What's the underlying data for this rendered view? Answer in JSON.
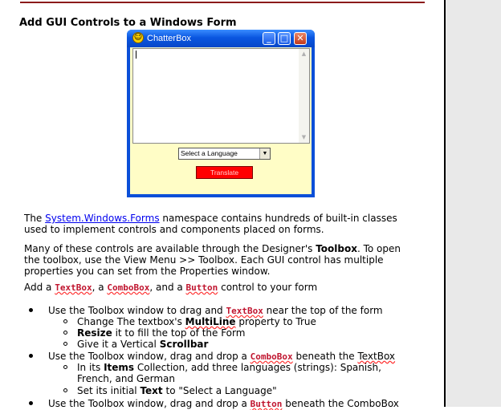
{
  "heading": "Add GUI Controls to a Windows Form",
  "window": {
    "title": "ChatterBox",
    "smiley": "☺",
    "minimize": "_",
    "maximize": "□",
    "close": "✕",
    "combo_value": "Select a Language",
    "combo_arrow": "▼",
    "button_label": "Translate",
    "scroll_up": "▲",
    "scroll_down": "▼"
  },
  "para1": {
    "pre": "The ",
    "link": "System.Windows.Forms",
    "post": " namespace contains hundreds of built-in classes",
    "line2": "used to implement controls and components placed on forms."
  },
  "para2": {
    "l1_pre": "Many of these controls are available through the Designer's ",
    "l1_bold": "Toolbox",
    "l1_post": ". To open",
    "line2": "the toolbox, use the View Menu >> Toolbox. Each GUI control has multiple",
    "line3": "properties you can set from the Properties window."
  },
  "para3": {
    "pre": "Add a ",
    "code1": "TextBox",
    "mid1": ", a ",
    "code2": "ComboBox",
    "mid2": ", and a ",
    "code3": "Button",
    "post": " control to your form"
  },
  "list": {
    "b1_pre": "Use the Toolbox window to drag and ",
    "b1_code": "TextBox",
    "b1_post": " near the top of the form",
    "s1_pre": "Change The textbox's ",
    "s1_bold": "MultiLine",
    "s1_post": " property to True",
    "s2_bold": "Resize",
    "s2_post": " it to fill the top of the Form",
    "s3_pre": "Give it a Vertical ",
    "s3_bold": "Scrollbar",
    "b2_pre": "Use the Toolbox window, drag and drop a ",
    "b2_code": "ComboBox",
    "b2_mid": " beneath the ",
    "b2_spell": "TextBox",
    "s4_pre": "In its ",
    "s4_bold": "Items",
    "s4_post": " Collection, add three languages (strings): Spanish,",
    "s4_line2": "French, and German",
    "s5_pre": "Set its initial ",
    "s5_bold": "Text",
    "s5_post": " to \"Select a Language\"",
    "b3_pre": "Use the Toolbox window, drag and drop a ",
    "b3_code": "Button",
    "b3_post": " beneath the ComboBox"
  }
}
